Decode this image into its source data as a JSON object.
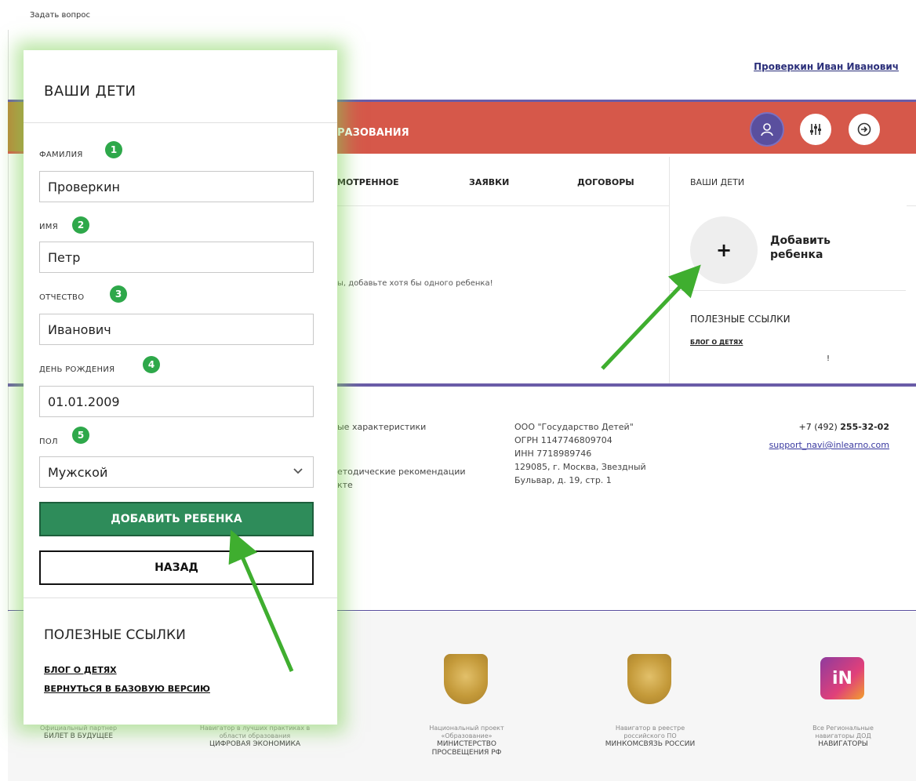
{
  "topbar": {
    "ask_question": "Задать вопрос"
  },
  "header": {
    "user_name": "Проверкин Иван Иванович"
  },
  "banner": {
    "title": "РАЗОВАНИЯ"
  },
  "tabs": [
    "МОТРЕННОЕ",
    "ЗАЯВКИ",
    "ДОГОВОРЫ"
  ],
  "side": {
    "title": "ВАШИ ДЕТИ",
    "add_child_line1": "Добавить",
    "add_child_line2": "ребенка",
    "plus": "+",
    "useful_title": "ПОЛЕЗНЫЕ ССЫЛКИ",
    "blog_link": "БЛОГ О ДЕТЯХ",
    "mark": "!"
  },
  "main_hint": "ы, добавьте хотя бы одного ребенка!",
  "footer": {
    "col1": [
      "ые характеристики",
      "",
      "етодические рекомендации",
      "кте"
    ],
    "org": [
      "ООО \"Государство Детей\"",
      "ОГРН 1147746809704",
      "ИНН 7718989746",
      "129085, г. Москва, Звездный",
      "Бульвар, д. 19, стр. 1"
    ],
    "phone_prefix": "+7 (492) ",
    "phone_main": "255-32-02",
    "email": "support_navi@inlearno.com"
  },
  "partners": [
    {
      "caption": "Официальный партнер",
      "name": "БИЛЕТ В БУДУЩЕЕ"
    },
    {
      "caption": "Навигатор в лучших практиках в области образования",
      "name": "ЦИФРОВАЯ ЭКОНОМИКА"
    },
    {
      "caption": "Национальный проект «Образование»",
      "name": "МИНИСТЕРСТВО ПРОСВЕЩЕНИЯ РФ"
    },
    {
      "caption": "Навигатор в реестре российского ПО",
      "name": "МИНКОМСВЯЗЬ РОССИИ"
    },
    {
      "caption": "Все Региональные навигаторы ДОД",
      "name": "НАВИГАТОРЫ"
    }
  ],
  "partner_logo_text": "iN",
  "modal": {
    "title": "ВАШИ ДЕТИ",
    "fields": [
      {
        "label": "ФАМИЛИЯ",
        "badge": "1",
        "value": "Проверкин"
      },
      {
        "label": "ИМЯ",
        "badge": "2",
        "value": "Петр"
      },
      {
        "label": "ОТЧЕСТВО",
        "badge": "3",
        "value": "Иванович"
      },
      {
        "label": "ДЕНЬ РОЖДЕНИЯ",
        "badge": "4",
        "value": "01.01.2009"
      },
      {
        "label": "ПОЛ",
        "badge": "5",
        "value": "Мужской"
      }
    ],
    "add_button": "ДОБАВИТЬ РЕБЕНКА",
    "back_button": "НАЗАД",
    "useful_title": "ПОЛЕЗНЫЕ ССЫЛКИ",
    "links": [
      "БЛОГ О ДЕТЯХ",
      "ВЕРНУТЬСЯ В БАЗОВУЮ ВЕРСИЮ"
    ]
  },
  "icons": {
    "user": "user-icon",
    "filter": "filter-icon",
    "exit": "exit-icon",
    "chevron": "chevron-down-icon"
  },
  "colors": {
    "banner": "#d6584a",
    "purple": "#6a5ca8",
    "green_button": "#2e8c5a",
    "badge": "#2ea84a",
    "arrow": "#3fae2f"
  }
}
